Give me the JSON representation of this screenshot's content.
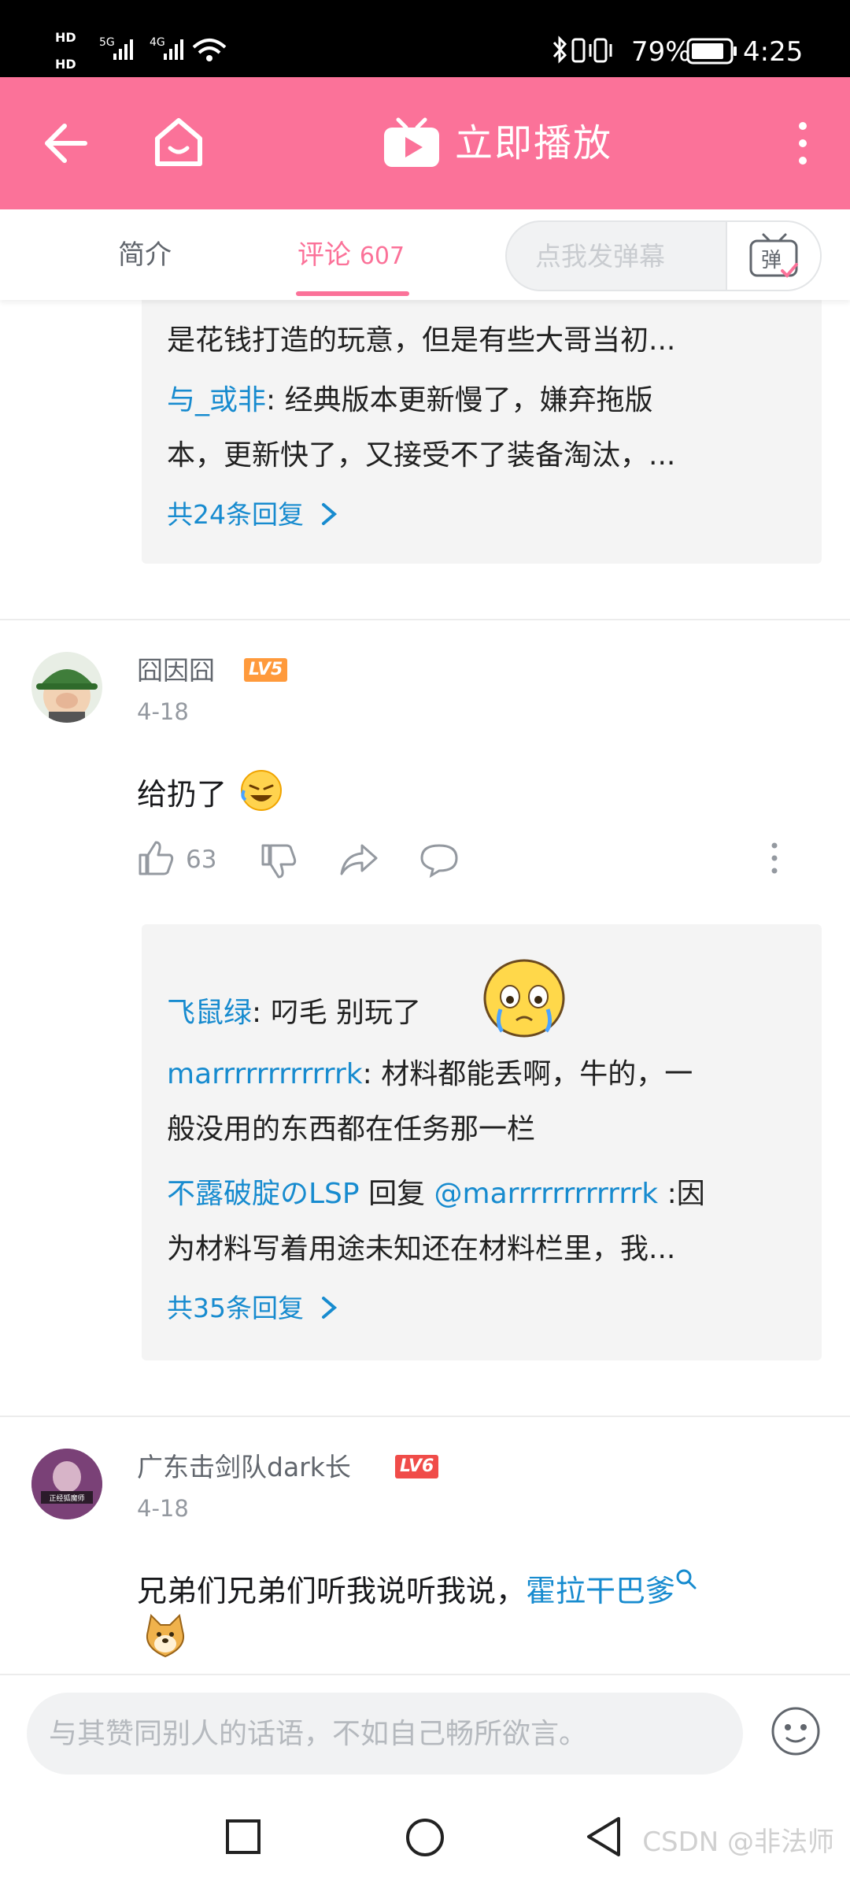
{
  "status_bar": {
    "network_left": "HD",
    "battery_percent": "79%",
    "time": "4:25"
  },
  "header": {
    "title": "立即播放"
  },
  "tabs": {
    "intro": "简介",
    "comments": "评论",
    "comments_count": "607",
    "danmaku_placeholder": "点我发弹幕",
    "danmaku_icon_text": "弹"
  },
  "thread1_replies": {
    "line1_tail": "是花钱打造的玩意，但是有些大哥当初...",
    "reply2_user": "与_或非",
    "reply2_line1": ": 经典版本更新慢了，嫌弃拖版",
    "reply2_line2": "本，更新快了，又接受不了装备淘汰，...",
    "more": "共24条回复"
  },
  "comment2": {
    "username": "囧因囧",
    "level": "LV5",
    "date": "4-18",
    "text": "给扔了",
    "likes": "63",
    "replies": {
      "r1_user": "飞鼠绿",
      "r1_text": ": 叼毛  别玩了",
      "r2_user": "marrrrrrrrrrrrk",
      "r2_text1": ": 材料都能丢啊，牛的，一",
      "r2_text2": "般没用的东西都在任务那一栏",
      "r3_user": "不露破腚のLSP",
      "r3_mid": " 回复 ",
      "r3_mention": "@marrrrrrrrrrrrk",
      "r3_text1": " :因",
      "r3_text2": "为材料写着用途未知还在材料栏里，我...",
      "more": "共35条回复"
    }
  },
  "comment3": {
    "username": "广东击剑队dark长",
    "level": "LV6",
    "date": "4-18",
    "text": "兄弟们兄弟们听我说听我说，",
    "link": "霍拉干巴爹",
    "avatar_caption": "正经狐魔师"
  },
  "input": {
    "placeholder": "与其赞同别人的话语，不如自己畅所欲言。"
  },
  "watermark": "CSDN @非法师",
  "colors": {
    "brand_pink": "#fb7299",
    "link_blue": "#178bcf",
    "lv5": "#ff9a3c",
    "lv6": "#f04c49"
  }
}
